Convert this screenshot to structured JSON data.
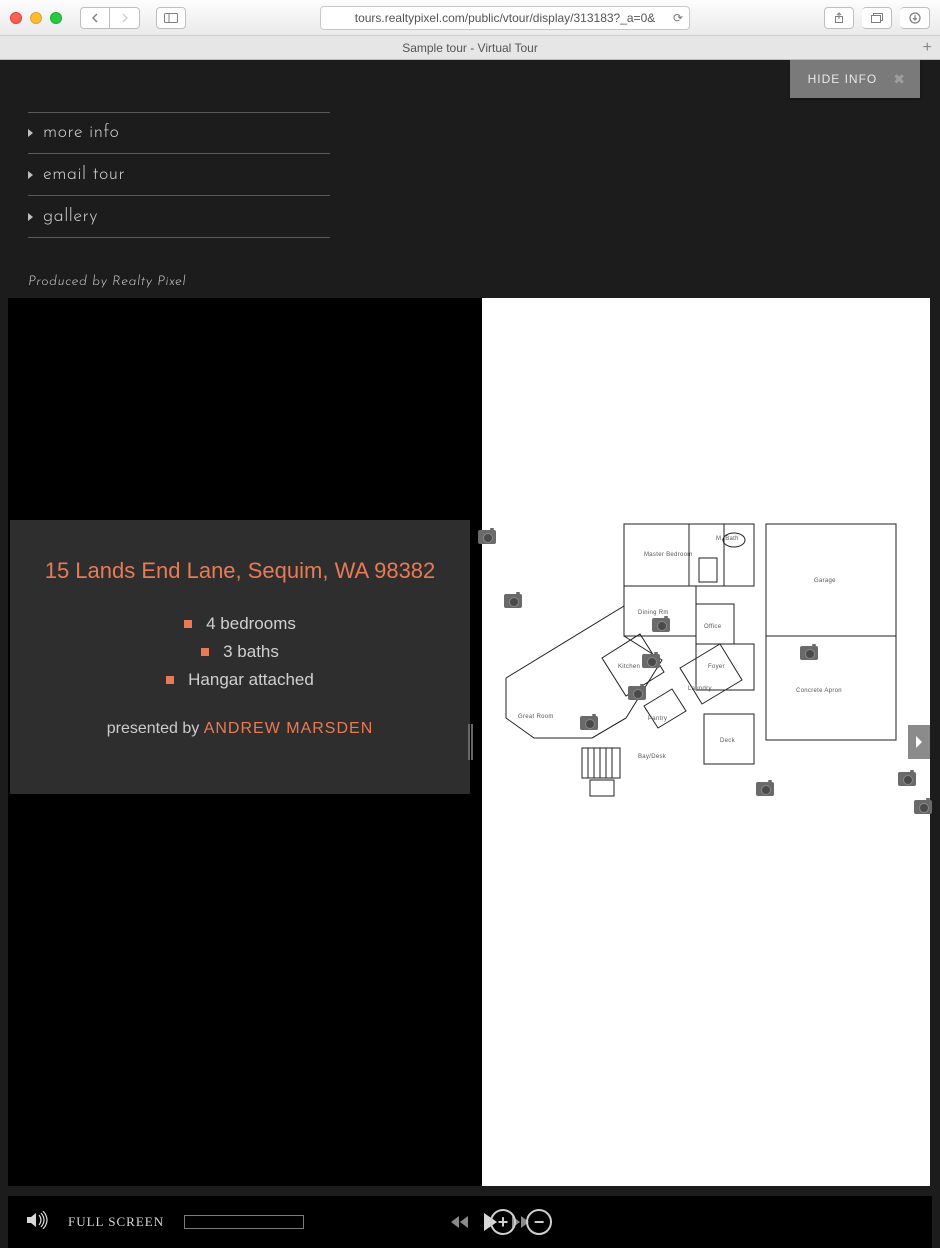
{
  "browser": {
    "url": "tours.realtypixel.com/public/vtour/display/313183?_a=0&",
    "tab_title": "Sample tour - Virtual Tour"
  },
  "header": {
    "hide_info": "HIDE INFO"
  },
  "menu": {
    "items": [
      "more info",
      "email tour",
      "gallery"
    ],
    "credit": "Produced by Realty Pixel"
  },
  "listing": {
    "address": "15 Lands End Lane, Sequim, WA 98382",
    "features": [
      "4 bedrooms",
      "3 baths",
      "Hangar attached"
    ],
    "presented_prefix": "presented by ",
    "presented_name": "ANDREW MARSDEN"
  },
  "floorplan_rooms": [
    "Master Bedroom",
    "M. Bath",
    "Garage",
    "Dining Rm",
    "Office",
    "Foyer",
    "Concrete Apron",
    "Kitchen",
    "Great Room",
    "Laundry",
    "Pantry",
    "Deck",
    "Bay/Desk"
  ],
  "controls": {
    "full_screen": "FULL SCREEN"
  }
}
